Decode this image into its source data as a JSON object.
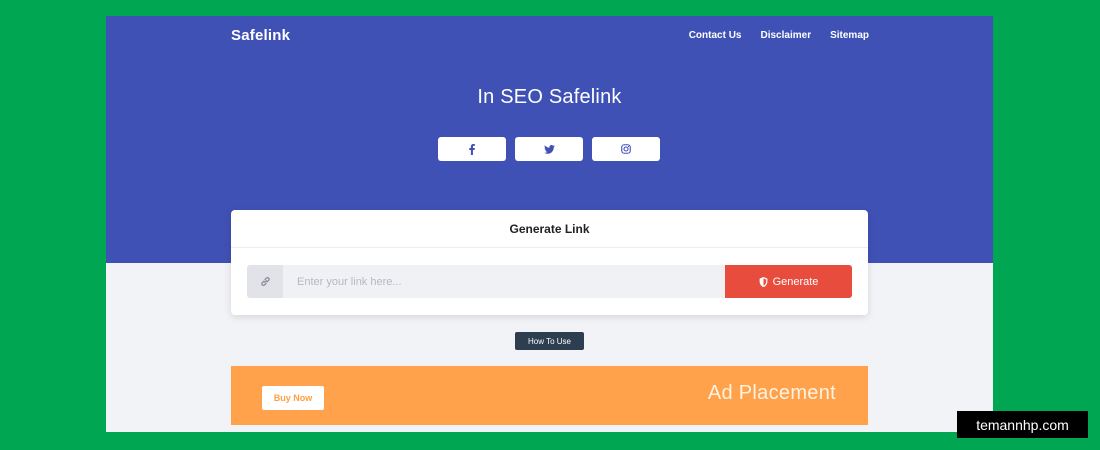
{
  "brand": "Safelink",
  "nav": {
    "items": [
      "Contact Us",
      "Disclaimer",
      "Sitemap"
    ]
  },
  "hero": {
    "title": "In SEO Safelink"
  },
  "socials": [
    {
      "icon": "facebook-icon"
    },
    {
      "icon": "twitter-icon"
    },
    {
      "icon": "instagram-icon"
    }
  ],
  "generator": {
    "title": "Generate Link",
    "input_placeholder": "Enter your link here...",
    "input_value": "",
    "link_icon": "link-icon",
    "button_icon": "shield-icon",
    "button_label": "Generate"
  },
  "how_to_use": "How To Use",
  "ad": {
    "buy_label": "Buy Now",
    "placement_text": "Ad Placement"
  },
  "watermark": "temannhp.com",
  "colors": {
    "background": "#00a651",
    "hero": "#3f51b5",
    "generate": "#e74c3c",
    "ad": "#ffa24b",
    "howto": "#2c3e50"
  }
}
